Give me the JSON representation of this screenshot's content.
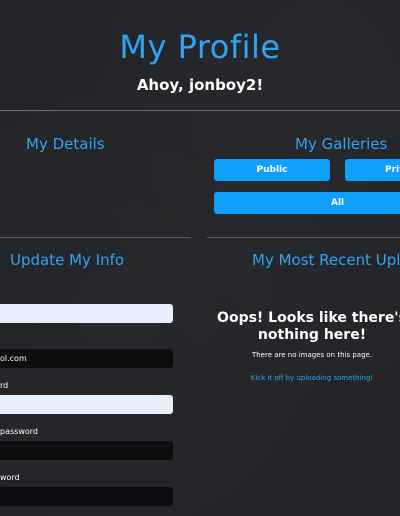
{
  "header": {
    "title": "My Profile",
    "greeting": "Ahoy, jonboy2!"
  },
  "details": {
    "heading": "My Details"
  },
  "galleries": {
    "heading": "My Galleries",
    "public_label": "Public",
    "private_label": "Private",
    "all_label": "All"
  },
  "update_info": {
    "heading": "Update My Info",
    "fields": [
      {
        "label": "",
        "value": ""
      },
      {
        "label": "",
        "value": "ol.com"
      },
      {
        "label": "rd",
        "value": ""
      },
      {
        "label": "password",
        "value": ""
      },
      {
        "label": "word",
        "value": ""
      }
    ]
  },
  "recent_uploads": {
    "heading": "My Most Recent Uploads",
    "empty_title": "Oops! Looks like there's nothing here!",
    "empty_text": "There are no images on this page.",
    "cta_link": "Kick it off by uploading something!"
  },
  "colors": {
    "accent": "#2fa4f2",
    "button": "#0fa0ff",
    "background": "#232427"
  }
}
